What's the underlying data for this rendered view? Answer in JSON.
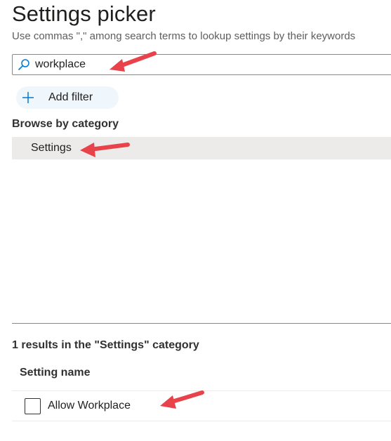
{
  "header": {
    "title": "Settings picker",
    "subtitle": "Use commas \",\" among search terms to lookup settings by their keywords"
  },
  "search": {
    "value": "workplace",
    "icon": "search-icon"
  },
  "filter": {
    "add_label": "Add filter",
    "icon": "plus-icon"
  },
  "browse": {
    "heading": "Browse by category",
    "categories": [
      {
        "label": "Settings",
        "selected": true
      }
    ]
  },
  "results": {
    "summary": "1 results in the \"Settings\" category",
    "column_header": "Setting name",
    "rows": [
      {
        "label": "Allow Workplace",
        "checked": false
      }
    ]
  },
  "colors": {
    "accent": "#0078d4",
    "annotation_arrow": "#e8424a",
    "selected_row": "#edebe9",
    "add_filter_bg": "#eff6fc"
  }
}
